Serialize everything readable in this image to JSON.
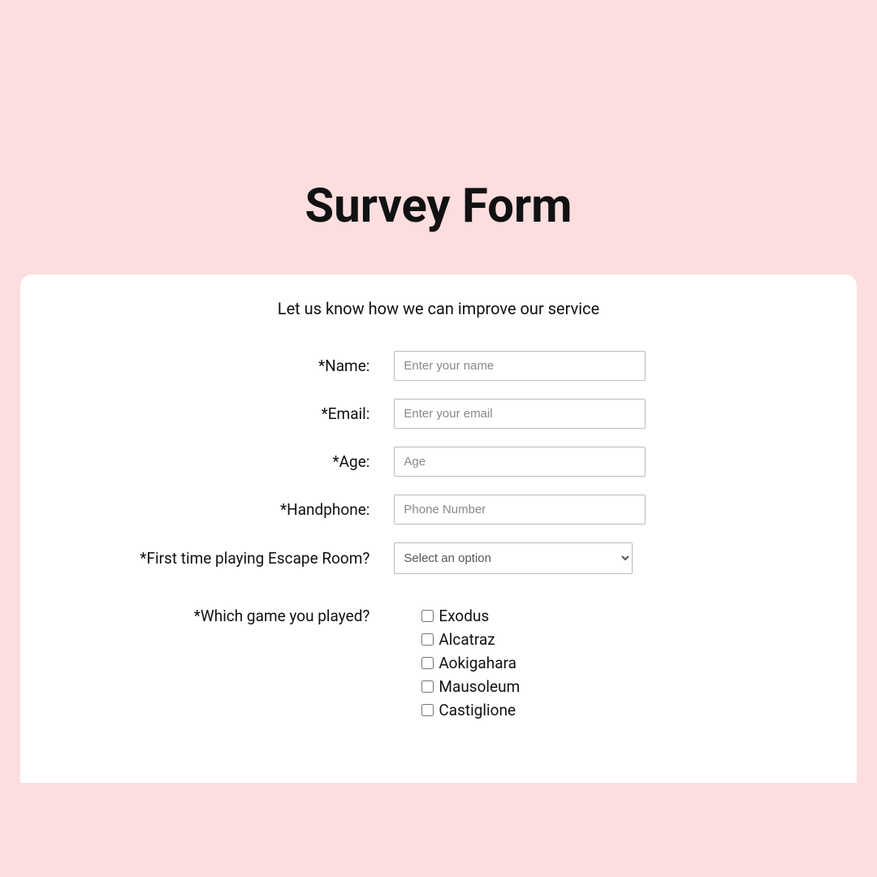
{
  "title": "Survey Form",
  "subtitle": "Let us know how we can improve our service",
  "fields": {
    "name": {
      "label": "*Name:",
      "placeholder": "Enter your name"
    },
    "email": {
      "label": "*Email:",
      "placeholder": "Enter your email"
    },
    "age": {
      "label": "*Age:",
      "placeholder": "Age"
    },
    "handphone": {
      "label": "*Handphone:",
      "placeholder": "Phone Number"
    },
    "firstTime": {
      "label": "*First time playing Escape Room?",
      "selected": "Select an option"
    },
    "whichGame": {
      "label": "*Which game you played?",
      "options": [
        "Exodus",
        "Alcatraz",
        "Aokigahara",
        "Mausoleum",
        "Castiglione"
      ]
    }
  }
}
